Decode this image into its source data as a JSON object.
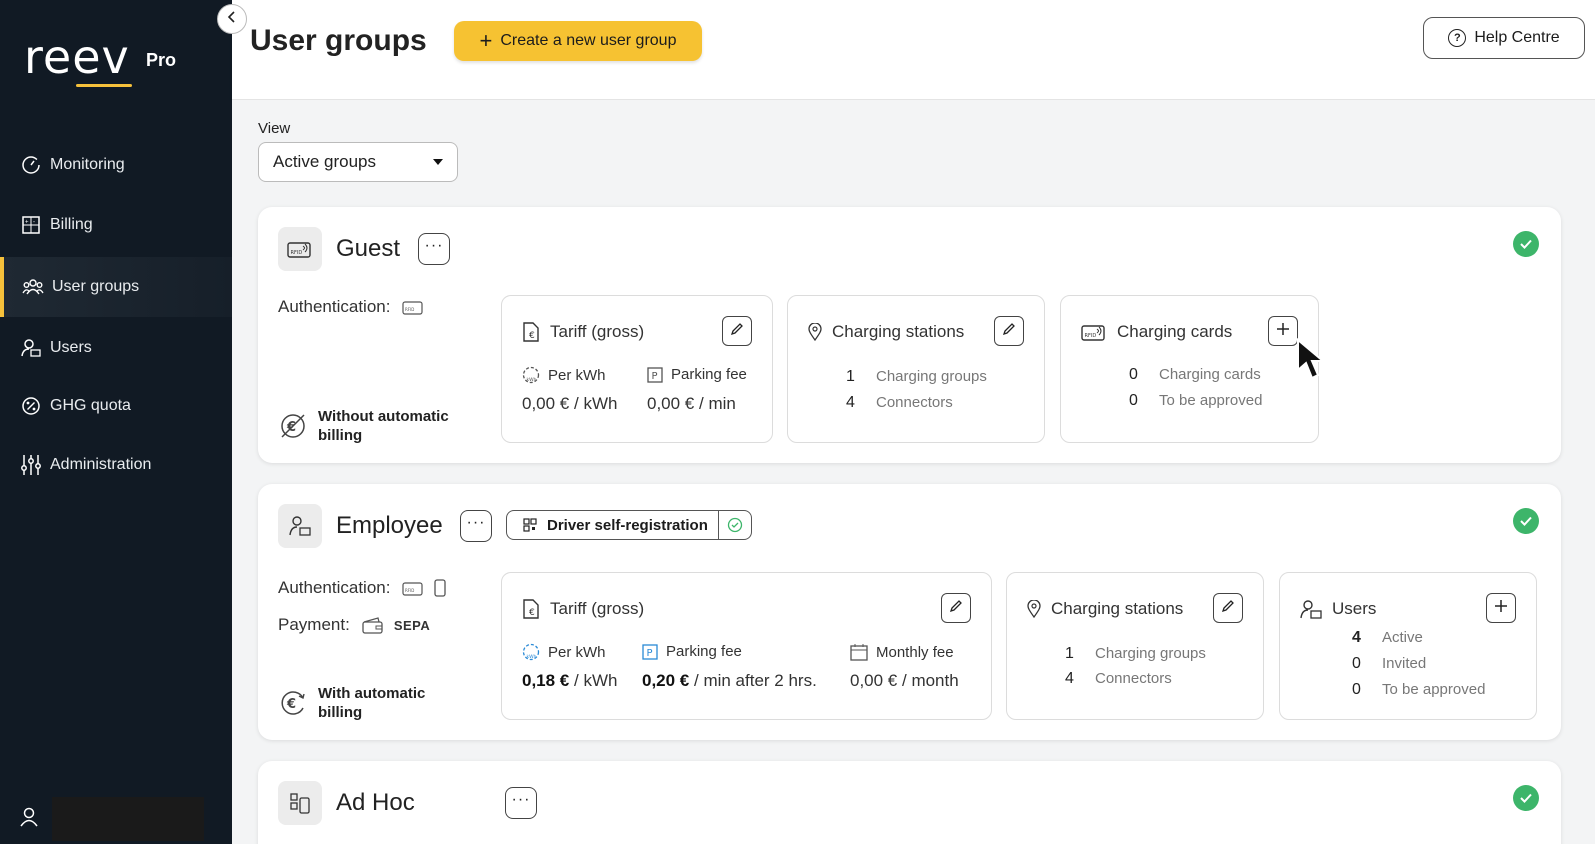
{
  "brand": {
    "name": "reev",
    "tier": "Pro",
    "accent": "#f6c13b"
  },
  "sidebar": {
    "items": [
      {
        "label": "Monitoring",
        "icon": "gauge-icon"
      },
      {
        "label": "Billing",
        "icon": "calculator-icon"
      },
      {
        "label": "User groups",
        "icon": "users-group-icon",
        "active": true
      },
      {
        "label": "Users",
        "icon": "user-card-icon"
      },
      {
        "label": "GHG quota",
        "icon": "percent-badge-icon"
      },
      {
        "label": "Administration",
        "icon": "sliders-icon"
      }
    ]
  },
  "header": {
    "title": "User groups",
    "create_label": "Create a new user group",
    "help_label": "Help Centre"
  },
  "view": {
    "label": "View",
    "selected": "Active groups"
  },
  "groups": [
    {
      "name": "Guest",
      "auth_label": "Authentication:",
      "billing": "Without automatic billing",
      "tariff": {
        "title": "Tariff (gross)",
        "per_kwh_label": "Per kWh",
        "per_kwh_value": "0,00 €",
        "per_kwh_unit": "/ kWh",
        "parking_label": "Parking fee",
        "parking_value": "0,00 €",
        "parking_unit": "/ min"
      },
      "stations": {
        "title": "Charging stations",
        "groups_count": "1",
        "groups_label": "Charging groups",
        "connectors_count": "4",
        "connectors_label": "Connectors"
      },
      "cards": {
        "title": "Charging cards",
        "cards_count": "0",
        "cards_label": "Charging cards",
        "approve_count": "0",
        "approve_label": "To be approved"
      }
    },
    {
      "name": "Employee",
      "badge": "Driver self-registration",
      "auth_label": "Authentication:",
      "payment_label": "Payment:",
      "payment_method": "SEPA",
      "billing": "With automatic billing",
      "tariff": {
        "title": "Tariff (gross)",
        "per_kwh_label": "Per kWh",
        "per_kwh_value": "0,18 €",
        "per_kwh_unit": "/ kWh",
        "parking_label": "Parking fee",
        "parking_value": "0,20 €",
        "parking_unit": "/ min after 2 hrs.",
        "monthly_label": "Monthly fee",
        "monthly_value": "0,00 €",
        "monthly_unit": "/ month"
      },
      "stations": {
        "title": "Charging stations",
        "groups_count": "1",
        "groups_label": "Charging groups",
        "connectors_count": "4",
        "connectors_label": "Connectors"
      },
      "users": {
        "title": "Users",
        "active_count": "4",
        "active_label": "Active",
        "invited_count": "0",
        "invited_label": "Invited",
        "approve_count": "0",
        "approve_label": "To be approved"
      }
    },
    {
      "name": "Ad Hoc"
    }
  ]
}
